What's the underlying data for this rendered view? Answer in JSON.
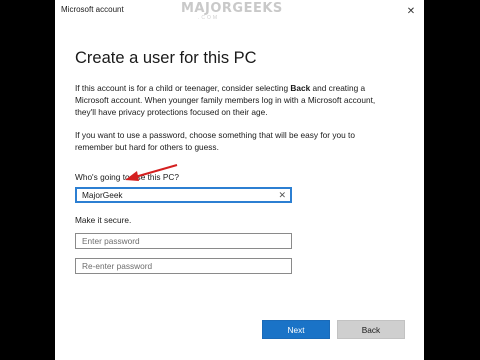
{
  "window": {
    "title": "Microsoft account",
    "watermark": "MAJORGEEKS",
    "watermark_sub": ".COM",
    "close_glyph": "✕"
  },
  "page": {
    "heading": "Create a user for this PC",
    "para1_pre": "If this account is for a child or teenager, consider selecting ",
    "para1_bold": "Back",
    "para1_post": " and creating a Microsoft account. When younger family members log in with a Microsoft account, they'll have privacy protections focused on their age.",
    "para2": "If you want to use a password, choose something that will be easy for you to remember but hard for others to guess.",
    "username_label": "Who's going to use this PC?",
    "username_value": "MajorGeek",
    "clear_glyph": "✕",
    "secure_label": "Make it secure.",
    "password_placeholder": "Enter password",
    "reenter_placeholder": "Re-enter password"
  },
  "buttons": {
    "next": "Next",
    "back": "Back"
  },
  "colors": {
    "accent": "#1a73c7",
    "annotation_arrow": "#d42020"
  }
}
